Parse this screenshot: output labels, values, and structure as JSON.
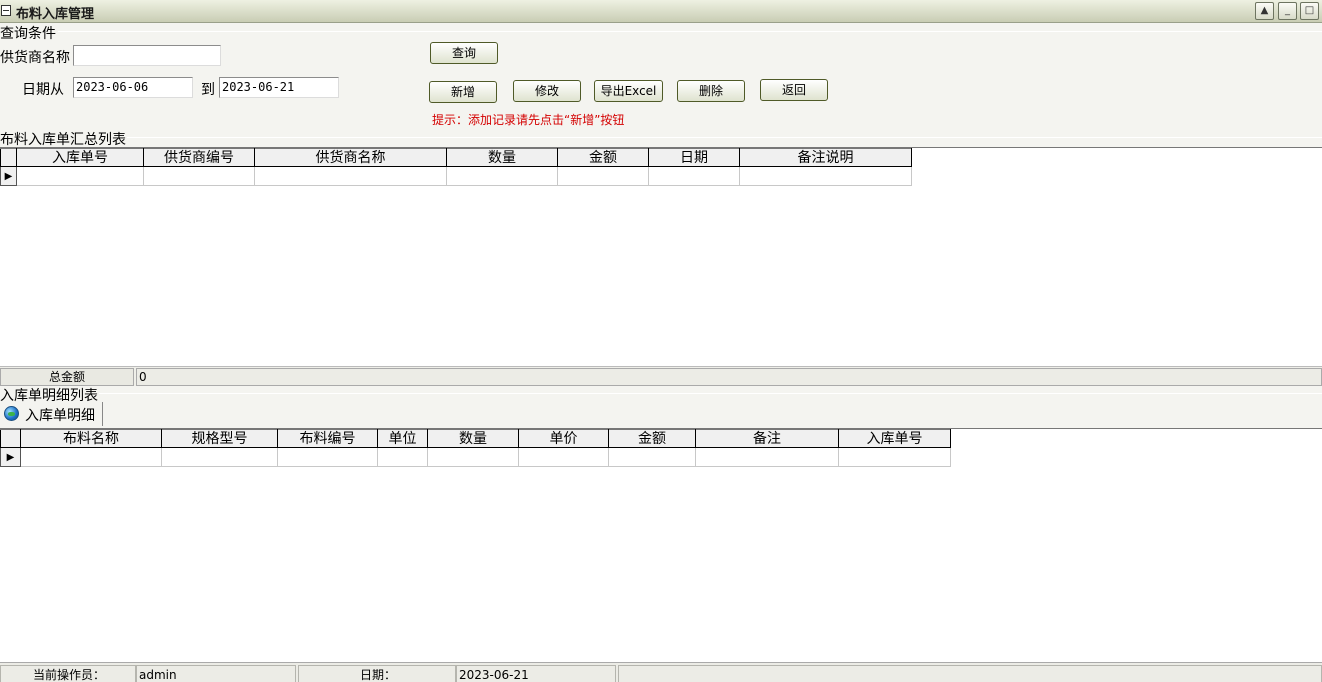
{
  "window": {
    "title": "布料入库管理",
    "minimize": "_",
    "maximize": "□"
  },
  "query": {
    "group_label": "查询条件",
    "supplier_label": "供货商名称",
    "supplier_value": "",
    "date_from_label": "日期从",
    "date_from": "2023-06-06",
    "date_to_label": "到",
    "date_to": "2023-06-21",
    "search_button": "查询"
  },
  "toolbar": {
    "add": "新增",
    "edit": "修改",
    "export": "导出Excel",
    "delete": "删除",
    "back": "返回",
    "hint": "提示：添加记录请先点击“新增”按钮"
  },
  "summary_grid": {
    "title": "布料入库单汇总列表",
    "columns": [
      "入库单号",
      "供货商编号",
      "供货商名称",
      "数量",
      "金额",
      "日期",
      "备注说明"
    ],
    "row_indicator": "▶"
  },
  "total": {
    "label": "总金额",
    "value": "0"
  },
  "detail": {
    "title": "入库单明细列表",
    "tab_label": "入库单明细",
    "columns": [
      "布料名称",
      "规格型号",
      "布料编号",
      "单位",
      "数量",
      "单价",
      "金额",
      "备注",
      "入库单号"
    ],
    "row_indicator": "▶"
  },
  "status": {
    "operator_label": "当前操作员：",
    "operator": "admin",
    "date_label": "日期：",
    "date": "2023-06-21"
  }
}
